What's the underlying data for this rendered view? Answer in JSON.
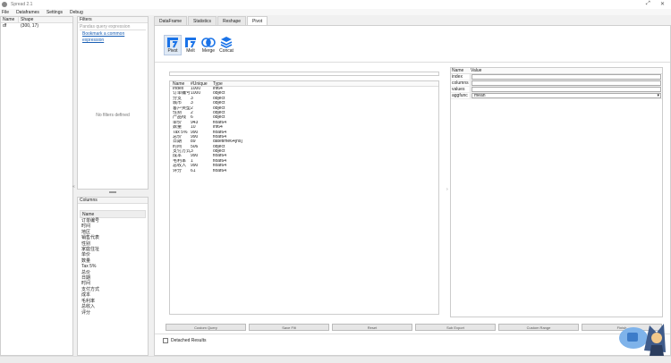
{
  "window": {
    "title": "Spread 2.1",
    "min_glyph": "⤢",
    "close_glyph": "✕"
  },
  "menu": [
    "File",
    "Dataframes",
    "Settings",
    "Debug"
  ],
  "df_list": {
    "headers": [
      "Name",
      "Shape"
    ],
    "rows": [
      {
        "name": "df",
        "shape": "(300, 17)"
      }
    ]
  },
  "filters": {
    "title": "Filters",
    "placeholder": "Pandas query expression",
    "link": "Bookmark a common expression",
    "empty": "No filters defined"
  },
  "columns_panel": {
    "title": "Columns",
    "header": "Name",
    "items": [
      "订单编号",
      "时间",
      "地区",
      "销售代表",
      "性别",
      "家庭住址",
      "单价",
      "数量",
      "Tax 5%",
      "总价",
      "日期",
      "时间",
      "支付方式",
      "成本",
      "毛利率",
      "总收入",
      "评分"
    ]
  },
  "tabs": [
    "DataFrame",
    "Statistics",
    "Reshape",
    "Pivot"
  ],
  "tabs_active": 3,
  "tools": [
    {
      "icon": "pivot-icon",
      "label": "Pivot"
    },
    {
      "icon": "melt-icon",
      "label": "Melt"
    },
    {
      "icon": "merge-icon",
      "label": "Merge"
    },
    {
      "icon": "concat-icon",
      "label": "Concat"
    }
  ],
  "col_table": {
    "headers": [
      "Name",
      "#Unique",
      "Type"
    ],
    "rows": [
      [
        "Index",
        "1000",
        "int64"
      ],
      [
        "订单编号",
        "1000",
        "object"
      ],
      [
        "分支",
        "3",
        "object"
      ],
      [
        "城市",
        "3",
        "object"
      ],
      [
        "客户类型",
        "2",
        "object"
      ],
      [
        "性别",
        "2",
        "object"
      ],
      [
        "产品线",
        "6",
        "object"
      ],
      [
        "单价",
        "943",
        "float64"
      ],
      [
        "数量",
        "10",
        "int64"
      ],
      [
        "Tax 5%",
        "990",
        "float64"
      ],
      [
        "总价",
        "990",
        "float64"
      ],
      [
        "日期",
        "89",
        "datetime64[ns]"
      ],
      [
        "时间",
        "506",
        "object"
      ],
      [
        "支付方式",
        "3",
        "object"
      ],
      [
        "成本",
        "990",
        "float64"
      ],
      [
        "毛利率",
        "1",
        "float64"
      ],
      [
        "总收入",
        "990",
        "float64"
      ],
      [
        "评分",
        "61",
        "float64"
      ]
    ]
  },
  "params": {
    "headers": [
      "Name",
      "Value"
    ],
    "rows": [
      "index",
      "columns",
      "values",
      "aggfunc"
    ],
    "aggfunc_value": "mean"
  },
  "bottom_buttons": [
    "Custom Query",
    "Save Filt",
    "Reset",
    "Sub Export",
    "Custom Range",
    "Finish"
  ],
  "checkbox": {
    "label": "Detached Results"
  },
  "accent": "#1a73e8"
}
